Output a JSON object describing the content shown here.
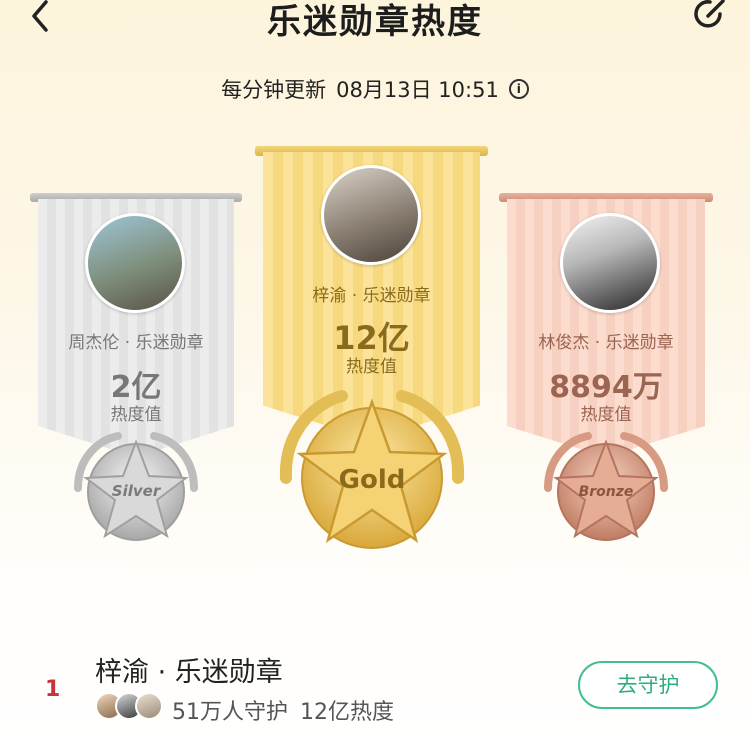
{
  "header": {
    "title": "乐迷勋章热度",
    "update_label": "每分钟更新",
    "update_time": "08月13日 10:51"
  },
  "podium": {
    "silver": {
      "artist": "周杰伦 · 乐迷勋章",
      "value": "2亿",
      "unit": "热度值",
      "medal_label": "Silver"
    },
    "gold": {
      "artist": "梓渝 · 乐迷勋章",
      "value": "12亿",
      "unit": "热度值",
      "medal_label": "Gold"
    },
    "bronze": {
      "artist": "林俊杰 · 乐迷勋章",
      "value": "8894万",
      "unit": "热度值",
      "medal_label": "Bronze"
    }
  },
  "ranking": [
    {
      "rank": "1",
      "name": "梓渝 · 乐迷勋章",
      "guardians": "51万人守护",
      "heat": "12亿热度",
      "action": "去守护"
    }
  ],
  "colors": {
    "accent_green": "#41bf8f",
    "rank_red": "#c9343a",
    "gold": "#e2b93f",
    "silver": "#bdbdbd",
    "bronze": "#d79a82"
  },
  "icons": {
    "back": "chevron-left-icon",
    "share": "share-icon",
    "info": "info-icon"
  }
}
